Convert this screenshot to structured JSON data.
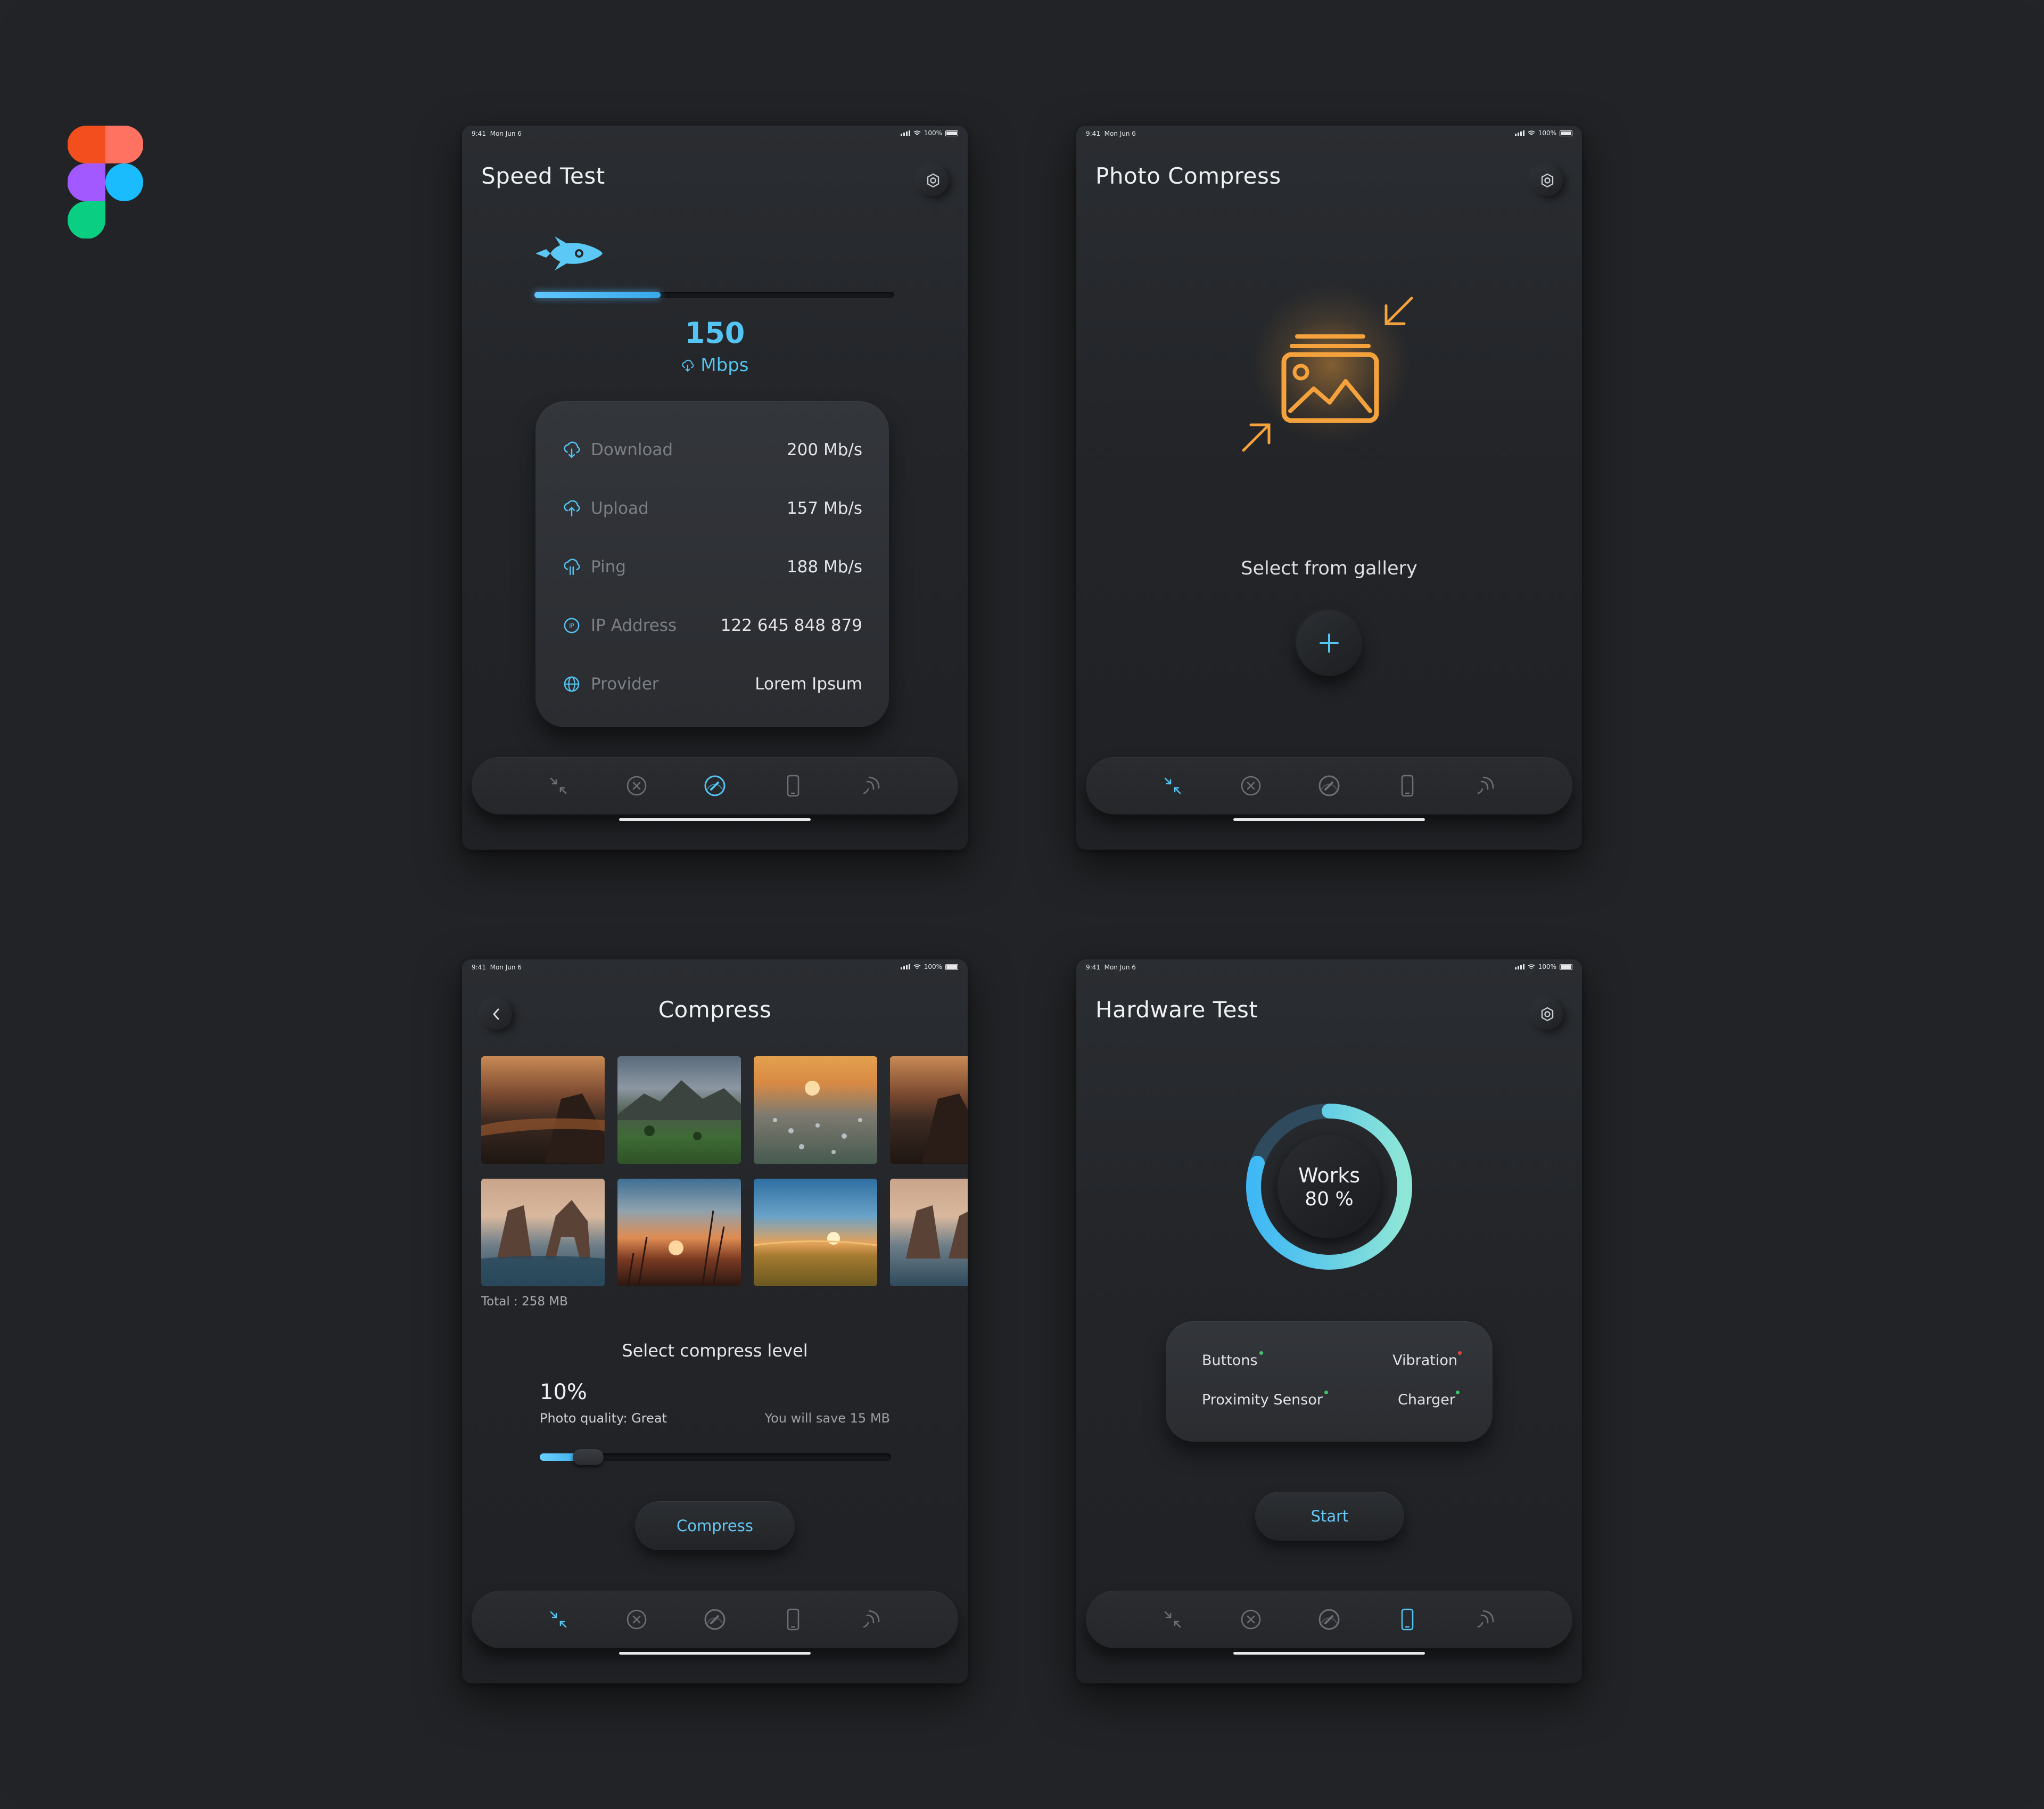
{
  "colors": {
    "accent": "#54c4f2",
    "orange": "#f5a23c",
    "green": "#3ec46b",
    "red": "#e0443c"
  },
  "status": {
    "time": "9:41",
    "date": "Mon Jun 6",
    "battery": "100%"
  },
  "speed_test": {
    "title": "Speed Test",
    "progress": 0.35,
    "value": "150",
    "unit": "Mbps",
    "rows": [
      {
        "icon": "cloud-download-icon",
        "label": "Download",
        "value": "200 Mb/s"
      },
      {
        "icon": "cloud-upload-icon",
        "label": "Upload",
        "value": "157 Mb/s"
      },
      {
        "icon": "cloud-ping-icon",
        "label": "Ping",
        "value": "188 Mb/s"
      },
      {
        "icon": "ip-icon",
        "label": "IP Address",
        "value": "122 645 848 879"
      },
      {
        "icon": "globe-icon",
        "label": "Provider",
        "value": "Lorem Ipsum"
      }
    ]
  },
  "photo_compress": {
    "title": "Photo Compress",
    "gallery_text": "Select from gallery"
  },
  "compress": {
    "title": "Compress",
    "total": "Total : 258 MB",
    "select_level": "Select compress level",
    "percent": "10%",
    "quality": "Photo quality:  Great",
    "save": "You will save 15 MB",
    "level": 0.1,
    "button": "Compress"
  },
  "hardware": {
    "title": "Hardware Test",
    "works": "Works",
    "percent": "80 %",
    "level": 0.8,
    "items": [
      {
        "label": "Buttons",
        "status": "ok"
      },
      {
        "label": "Vibration",
        "status": "fail"
      },
      {
        "label": "Proximity Sensor",
        "status": "ok"
      },
      {
        "label": "Charger",
        "status": "ok"
      }
    ],
    "button": "Start"
  },
  "nav": {
    "items": [
      "compress-icon",
      "close-circle-icon",
      "speedometer-icon",
      "phone-icon",
      "signal-icon"
    ],
    "active": {
      "speed_test": 2,
      "photo_compress": 0,
      "compress": 0,
      "hardware": 3
    }
  }
}
